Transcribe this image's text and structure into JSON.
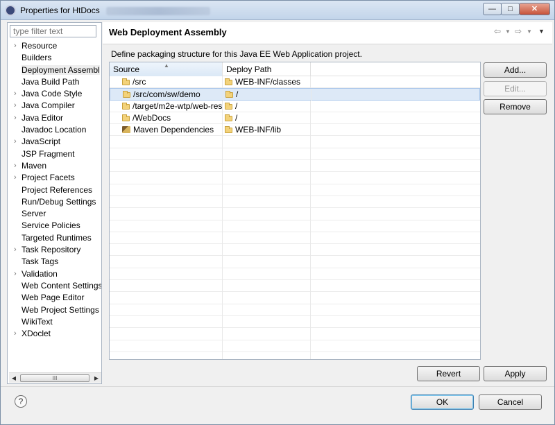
{
  "window": {
    "title": "Properties for HtDocs"
  },
  "filter": {
    "placeholder": "type filter text"
  },
  "tree": [
    {
      "label": "Resource",
      "expandable": true
    },
    {
      "label": "Builders",
      "expandable": false
    },
    {
      "label": "Deployment Assembl",
      "expandable": false,
      "selected": true
    },
    {
      "label": "Java Build Path",
      "expandable": false
    },
    {
      "label": "Java Code Style",
      "expandable": true
    },
    {
      "label": "Java Compiler",
      "expandable": true
    },
    {
      "label": "Java Editor",
      "expandable": true
    },
    {
      "label": "Javadoc Location",
      "expandable": false
    },
    {
      "label": "JavaScript",
      "expandable": true
    },
    {
      "label": "JSP Fragment",
      "expandable": false
    },
    {
      "label": "Maven",
      "expandable": true
    },
    {
      "label": "Project Facets",
      "expandable": true
    },
    {
      "label": "Project References",
      "expandable": false
    },
    {
      "label": "Run/Debug Settings",
      "expandable": false
    },
    {
      "label": "Server",
      "expandable": false
    },
    {
      "label": "Service Policies",
      "expandable": false
    },
    {
      "label": "Targeted Runtimes",
      "expandable": false
    },
    {
      "label": "Task Repository",
      "expandable": true
    },
    {
      "label": "Task Tags",
      "expandable": false
    },
    {
      "label": "Validation",
      "expandable": true
    },
    {
      "label": "Web Content Settings",
      "expandable": false
    },
    {
      "label": "Web Page Editor",
      "expandable": false
    },
    {
      "label": "Web Project Settings",
      "expandable": false
    },
    {
      "label": "WikiText",
      "expandable": false
    },
    {
      "label": "XDoclet",
      "expandable": true
    }
  ],
  "page": {
    "title": "Web Deployment Assembly",
    "description": "Define packaging structure for this Java EE Web Application project."
  },
  "table": {
    "columns": [
      "Source",
      "Deploy Path"
    ],
    "rows": [
      {
        "source": "/src",
        "source_icon": "folder-icon",
        "deploy_path": "WEB-INF/classes",
        "selected": false
      },
      {
        "source": "/src/com/sw/demo",
        "source_icon": "folder-icon",
        "deploy_path": "/",
        "selected": true
      },
      {
        "source": "/target/m2e-wtp/web-res",
        "source_icon": "folder-icon",
        "deploy_path": "/",
        "selected": false
      },
      {
        "source": "/WebDocs",
        "source_icon": "folder-icon",
        "deploy_path": "/",
        "selected": false
      },
      {
        "source": "Maven Dependencies",
        "source_icon": "maven-library-icon",
        "deploy_path": "WEB-INF/lib",
        "selected": false
      }
    ]
  },
  "buttons": {
    "add": "Add...",
    "edit": "Edit...",
    "remove": "Remove",
    "revert": "Revert",
    "apply": "Apply",
    "ok": "OK",
    "cancel": "Cancel"
  },
  "scrollbar": {
    "thumb": "III"
  },
  "help_symbol": "?"
}
